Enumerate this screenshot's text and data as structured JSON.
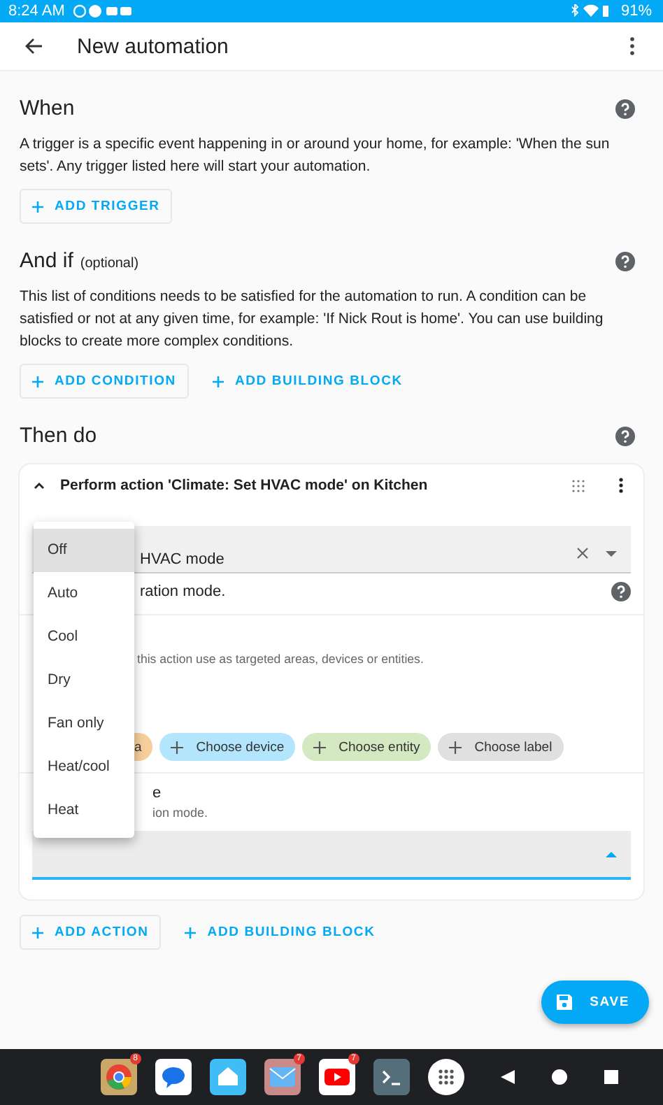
{
  "status_bar": {
    "time": "8:24 AM",
    "battery": "91%"
  },
  "app_bar": {
    "title": "New automation"
  },
  "when": {
    "title": "When",
    "description": "A trigger is a specific event happening in or around your home, for example: 'When the sun sets'. Any trigger listed here will start your automation.",
    "buttons": [
      {
        "label": "ADD TRIGGER",
        "outlined": true
      }
    ]
  },
  "and_if": {
    "title": "And if",
    "note": "(optional)",
    "description": "This list of conditions needs to be satisfied for the automation to run. A condition can be satisfied or not at any given time, for example: 'If Nick Rout is home'. You can use building blocks to create more complex conditions.",
    "buttons": [
      {
        "label": "ADD CONDITION",
        "outlined": true
      },
      {
        "label": "ADD BUILDING BLOCK",
        "outlined": false
      }
    ]
  },
  "then_do": {
    "title": "Then do",
    "action": {
      "title": "Perform action 'Climate: Set HVAC mode' on Kitchen",
      "expanded": true,
      "action_field": {
        "value": "HVAC mode"
      },
      "action_description": "ration mode.",
      "target_description": "this action use as targeted areas, devices or entities.",
      "chips": [
        {
          "label": "a",
          "color": "#f6cf9c"
        },
        {
          "label": "Choose device",
          "color": "#b3e5fc"
        },
        {
          "label": "Choose entity",
          "color": "#d4e8c1"
        },
        {
          "label": "Choose label",
          "color": "#e0e0e0"
        }
      ],
      "mode_title": "e",
      "mode_description": "ion mode.",
      "mode_menu": [
        {
          "label": "Off",
          "selected": true
        },
        {
          "label": "Auto",
          "selected": false
        },
        {
          "label": "Cool",
          "selected": false
        },
        {
          "label": "Dry",
          "selected": false
        },
        {
          "label": "Fan only",
          "selected": false
        },
        {
          "label": "Heat/cool",
          "selected": false
        },
        {
          "label": "Heat",
          "selected": false
        }
      ]
    },
    "buttons": [
      {
        "label": "ADD ACTION",
        "outlined": true
      },
      {
        "label": "ADD BUILDING BLOCK",
        "outlined": false
      }
    ]
  },
  "save_button": {
    "label": "SAVE"
  },
  "taskbar": [
    {
      "kind": "chrome",
      "badge": "8"
    },
    {
      "kind": "messages"
    },
    {
      "kind": "home"
    },
    {
      "kind": "mail",
      "badge": "7"
    },
    {
      "kind": "youtube",
      "badge": "7"
    },
    {
      "kind": "terminal"
    },
    {
      "kind": "apps"
    }
  ]
}
